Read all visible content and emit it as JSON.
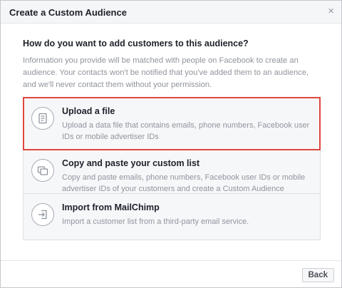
{
  "dialog": {
    "title": "Create a Custom Audience",
    "close_glyph": "×"
  },
  "main": {
    "question": "How do you want to add customers to this audience?",
    "info": "Information you provide will be matched with people on Facebook to create an audience. Your contacts won't be notified that you've added them to an audience, and we'll never contact them without your permission."
  },
  "options": [
    {
      "title": "Upload a file",
      "description": "Upload a data file that contains emails, phone numbers, Facebook user IDs or mobile advertiser IDs",
      "icon": "document-icon",
      "selected": true
    },
    {
      "title": "Copy and paste your custom list",
      "description": "Copy and paste emails, phone numbers, Facebook user IDs or mobile advertiser IDs of your customers and create a Custom Audience",
      "icon": "copy-icon",
      "selected": false
    },
    {
      "title": "Import from MailChimp",
      "description": "Import a customer list from a third-party email service.",
      "icon": "import-icon",
      "selected": false
    }
  ],
  "footer": {
    "back_label": "Back"
  },
  "colors": {
    "selection_outline": "#e0463f",
    "icon_stroke": "#a6abb5"
  }
}
